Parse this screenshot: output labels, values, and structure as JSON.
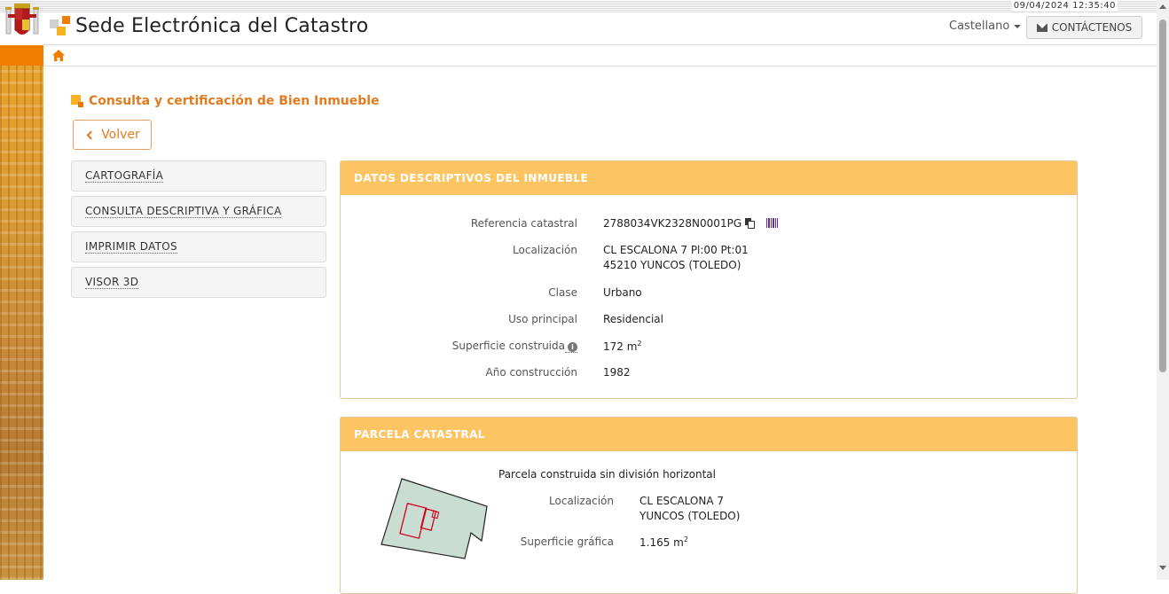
{
  "topbar": {
    "datetime": "09/04/2024  12:35:40"
  },
  "header": {
    "title": "Sede Electrónica del Catastro",
    "language": "Castellano",
    "contact_label": "CONTÁCTENOS"
  },
  "page": {
    "title": "Consulta y certificación de Bien Inmueble",
    "back_label": "Volver"
  },
  "menu": {
    "items": [
      {
        "label": "CARTOGRAFÍA"
      },
      {
        "label": "CONSULTA DESCRIPTIVA Y GRÁFICA"
      },
      {
        "label": "IMPRIMIR DATOS"
      },
      {
        "label": "VISOR 3D"
      }
    ]
  },
  "descriptive": {
    "heading": "DATOS DESCRIPTIVOS DEL INMUEBLE",
    "fields": {
      "ref_label": "Referencia catastral",
      "ref_value": "2788034VK2328N0001PG",
      "loc_label": "Localización",
      "loc_line1": "CL ESCALONA 7 Pl:00 Pt:01",
      "loc_line2": "45210 YUNCOS (TOLEDO)",
      "class_label": "Clase",
      "class_value": "Urbano",
      "use_label": "Uso principal",
      "use_value": "Residencial",
      "area_label": "Superficie construida",
      "area_value": "172 m",
      "area_unit_sup": "2",
      "year_label": "Año construcción",
      "year_value": "1982"
    }
  },
  "parcel": {
    "heading": "PARCELA CATASTRAL",
    "type": "Parcela construida sin división horizontal",
    "loc_label": "Localización",
    "loc_line1": "CL ESCALONA 7",
    "loc_line2": "YUNCOS (TOLEDO)",
    "area_label": "Superficie gráfica",
    "area_value": "1.165 m",
    "area_unit_sup": "2"
  },
  "colors": {
    "accent": "#e07b20",
    "panel_header": "#fcc462",
    "parcel_fill": "#c9ddd3",
    "building_stroke": "#d4001a"
  },
  "icons": [
    "coat-of-arms-icon",
    "catastro-logo-icon",
    "mail-icon",
    "home-icon",
    "chevron-left-icon",
    "copy-icon",
    "barcode-icon",
    "info-icon"
  ]
}
